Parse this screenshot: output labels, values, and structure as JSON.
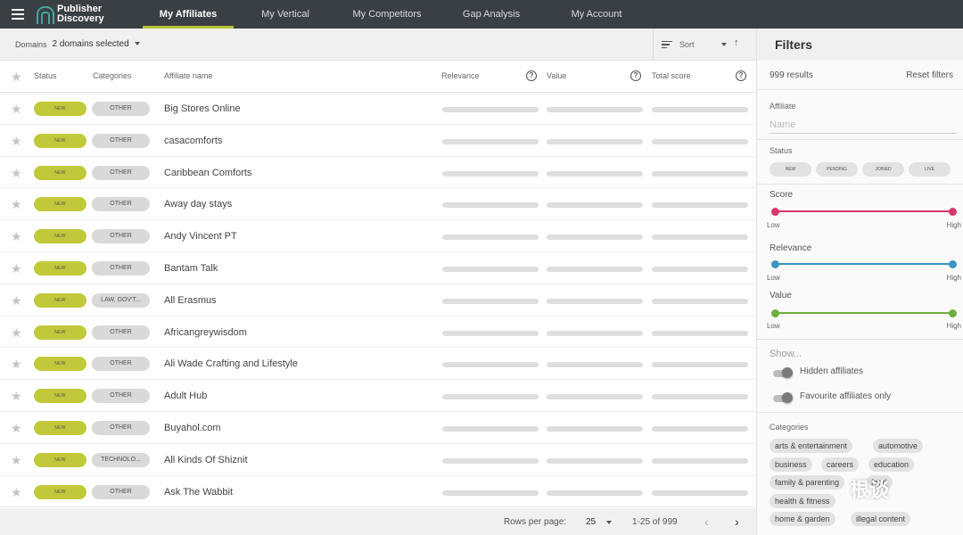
{
  "app": {
    "logo_line1": "Publisher",
    "logo_line2": "Discovery"
  },
  "nav": {
    "items": [
      {
        "label": "My Affiliates",
        "active": true
      },
      {
        "label": "My Vertical"
      },
      {
        "label": "My Competitors"
      },
      {
        "label": "Gap Analysis"
      },
      {
        "label": "My Account"
      }
    ]
  },
  "toolbar": {
    "domains_label": "Domains",
    "domains_value": "2 domains selected",
    "sort_label": "Sort"
  },
  "table": {
    "headers": {
      "status": "Status",
      "categories": "Categories",
      "name": "Affiliate name",
      "relevance": "Relevance",
      "value": "Value",
      "total": "Total score"
    },
    "rows": [
      {
        "status": "NEW",
        "category": "OTHER",
        "name": "Big Stores Online"
      },
      {
        "status": "NEW",
        "category": "OTHER",
        "name": "casacomforts"
      },
      {
        "status": "NEW",
        "category": "OTHER",
        "name": "Caribbean Comforts"
      },
      {
        "status": "NEW",
        "category": "OTHER",
        "name": "Away day stays"
      },
      {
        "status": "NEW",
        "category": "OTHER",
        "name": "Andy Vincent PT"
      },
      {
        "status": "NEW",
        "category": "OTHER",
        "name": "Bantam Talk"
      },
      {
        "status": "NEW",
        "category": "LAW, GOV'T...",
        "name": "All Erasmus"
      },
      {
        "status": "NEW",
        "category": "OTHER",
        "name": "Africangreywisdom"
      },
      {
        "status": "NEW",
        "category": "OTHER",
        "name": "Ali Wade Crafting and Lifestyle"
      },
      {
        "status": "NEW",
        "category": "OTHER",
        "name": "Adult Hub"
      },
      {
        "status": "NEW",
        "category": "OTHER",
        "name": "Buyahol.com"
      },
      {
        "status": "NEW",
        "category": "TECHNOLO...",
        "name": "All Kinds Of Shiznit"
      },
      {
        "status": "NEW",
        "category": "OTHER",
        "name": "Ask The Wabbit"
      }
    ]
  },
  "footer": {
    "rows_per_page_label": "Rows per page:",
    "rows_per_page_value": "25",
    "range": "1-25 of 999",
    "prev": "‹",
    "next": "›"
  },
  "filters": {
    "title": "Filters",
    "results": "999 results",
    "reset": "Reset filters",
    "affiliate_label": "Affiliate",
    "affiliate_placeholder": "Name",
    "status_label": "Status",
    "status_options": [
      "NEW",
      "PENDING",
      "JOINED",
      "LIVE"
    ],
    "score_label": "Score",
    "relevance_label": "Relevance",
    "value_label": "Value",
    "low": "Low",
    "high": "High",
    "show_label": "Show...",
    "hidden_affiliates": "Hidden affiliates",
    "favourite_only": "Favourite affiliates only",
    "categories_label": "Categories",
    "categories": [
      "arts & entertainment",
      "automotive",
      "business",
      "careers",
      "education",
      "family & parenting",
      "food",
      "health & fitness",
      "home & garden",
      "illegal content"
    ]
  },
  "colors": {
    "accent": "#b5c23a",
    "status_new": "#c1c93a",
    "score": "#d6386b",
    "relevance": "#3a94c4",
    "value": "#6fae3e",
    "topbar": "#3a3f44"
  },
  "watermark": "根谈"
}
